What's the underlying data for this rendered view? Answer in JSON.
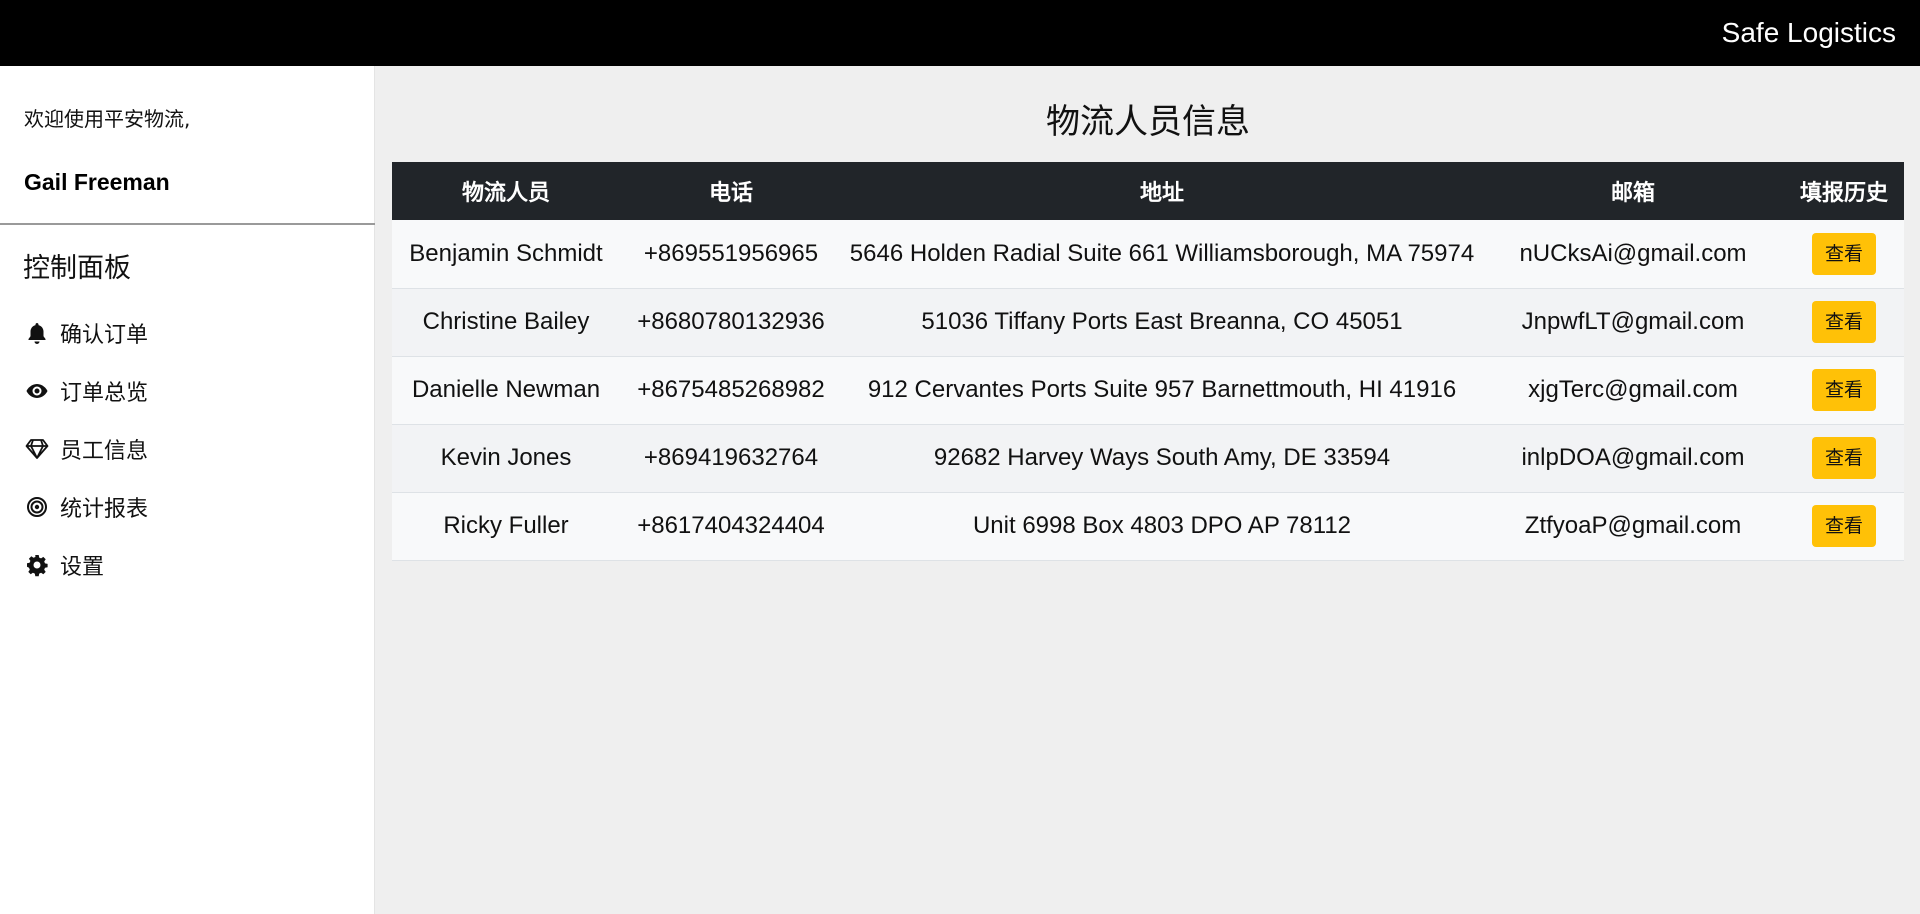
{
  "header": {
    "brand": "Safe Logistics"
  },
  "sidebar": {
    "welcome": "欢迎使用平安物流,",
    "username": "Gail Freeman",
    "panel_title": "控制面板",
    "items": [
      {
        "label": "确认订单",
        "icon": "bell-icon"
      },
      {
        "label": "订单总览",
        "icon": "eye-icon"
      },
      {
        "label": "员工信息",
        "icon": "diamond-icon"
      },
      {
        "label": "统计报表",
        "icon": "target-icon"
      },
      {
        "label": "设置",
        "icon": "gear-icon"
      }
    ]
  },
  "main": {
    "title": "物流人员信息",
    "columns": [
      "物流人员",
      "电话",
      "地址",
      "邮箱",
      "填报历史"
    ],
    "rows": [
      {
        "name": "Benjamin Schmidt",
        "phone": "+869551956965",
        "address": "5646 Holden Radial Suite 661 Williamsborough, MA 75974",
        "email": "nUCksAi@gmail.com",
        "action": "查看"
      },
      {
        "name": "Christine Bailey",
        "phone": "+8680780132936",
        "address": "51036 Tiffany Ports East Breanna, CO 45051",
        "email": "JnpwfLT@gmail.com",
        "action": "查看"
      },
      {
        "name": "Danielle Newman",
        "phone": "+8675485268982",
        "address": "912 Cervantes Ports Suite 957 Barnettmouth, HI 41916",
        "email": "xjgTerc@gmail.com",
        "action": "查看"
      },
      {
        "name": "Kevin Jones",
        "phone": "+869419632764",
        "address": "92682 Harvey Ways South Amy, DE 33594",
        "email": "inlpDOA@gmail.com",
        "action": "查看"
      },
      {
        "name": "Ricky Fuller",
        "phone": "+8617404324404",
        "address": "Unit 6998 Box 4803 DPO AP 78112",
        "email": "ZtfyoaP@gmail.com",
        "action": "查看"
      }
    ]
  },
  "colors": {
    "topbar": "#000000",
    "table_header": "#212529",
    "button": "#ffc107"
  }
}
